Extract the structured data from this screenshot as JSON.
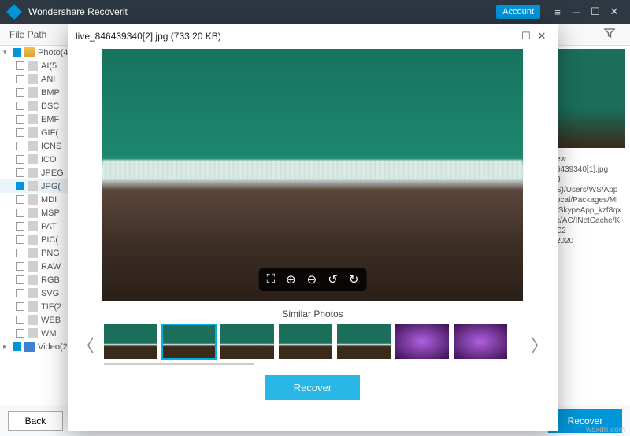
{
  "titlebar": {
    "app_name": "Wondershare Recoverit",
    "account_label": "Account"
  },
  "toolbar": {
    "file_path_label": "File Path"
  },
  "sidebar": {
    "root": {
      "label": "Photo(4"
    },
    "items": [
      "AI(5",
      "ANI",
      "BMP",
      "DSC",
      "EMF",
      "GIF(",
      "ICNS",
      "ICO",
      "JPEG",
      "JPG(",
      "MDI",
      "MSP",
      "PAT",
      "PIC(",
      "PNG",
      "RAW",
      "RGB",
      "SVG",
      "TIF(2",
      "WEB",
      "WM"
    ],
    "selected_index": 9,
    "video": {
      "label": "Video(2"
    }
  },
  "right_panel": {
    "preview_label": "ew",
    "filename": "6439340[1].jpg",
    "field2": "3",
    "path_lines": [
      "S)/Users/WS/App",
      "ocal/Packages/Mi",
      ".SkypeApp_kzf8qx",
      "c/AC/INetCache/K",
      "C2"
    ],
    "date": "2020"
  },
  "bottom": {
    "back_label": "Back",
    "recover_label": "Recover"
  },
  "modal": {
    "filename": "live_846439340[2].jpg (733.20 KB)",
    "similar_label": "Similar Photos",
    "recover_label": "Recover"
  },
  "watermark": "wsxdn.com"
}
